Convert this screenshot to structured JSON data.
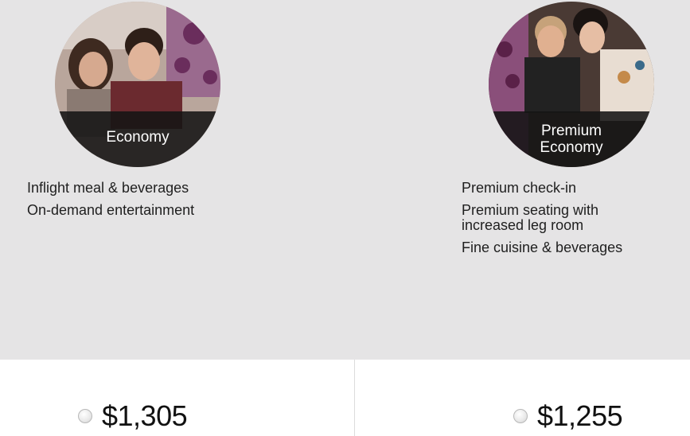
{
  "fares": [
    {
      "cabin_label": "Economy",
      "features": [
        "Inflight meal & beverages",
        "On-demand entertainment"
      ],
      "price": "$1,305",
      "photo_icon": "passengers-photo"
    },
    {
      "cabin_label_line1": "Premium",
      "cabin_label_line2": "Economy",
      "features": [
        "Premium check-in",
        "Premium seating with increased leg room",
        "Fine cuisine & beverages"
      ],
      "price": "$1,255",
      "photo_icon": "passengers-photo"
    }
  ],
  "colors": {
    "panel_background": "#e5e4e5",
    "label_band": "#141414",
    "text": "#1f1f1f"
  }
}
